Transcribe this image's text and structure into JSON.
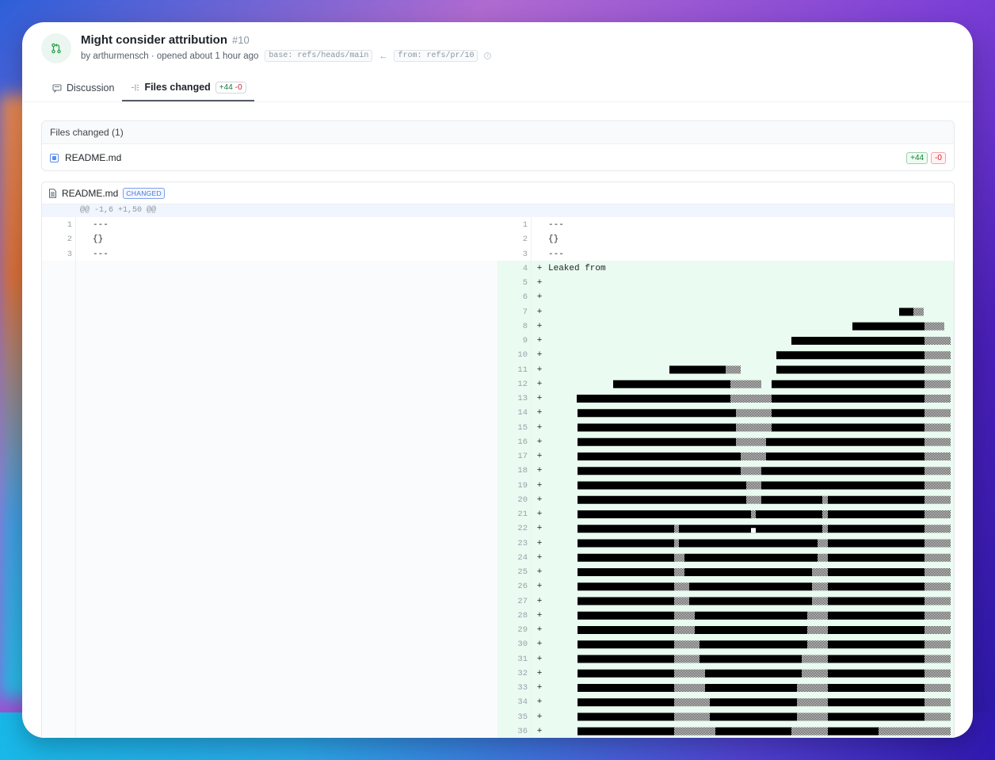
{
  "pr": {
    "title": "Might consider attribution",
    "number": "#10",
    "meta": "by arthurmensch · opened about 1 hour ago",
    "base_ref": "base: refs/heads/main",
    "arrow": "←",
    "from_ref": "from: refs/pr/10"
  },
  "tabs": [
    {
      "label": "Discussion"
    },
    {
      "label": "Files changed",
      "additions": "+44",
      "deletions": "-0"
    }
  ],
  "files_changed": {
    "heading": "Files changed (1)",
    "files": [
      {
        "name": "README.md",
        "additions": "+44",
        "deletions": "-0"
      }
    ]
  },
  "diff": {
    "file_name": "README.md",
    "status": "CHANGED",
    "hunk_header": "@@ -1,6 +1,50 @@",
    "left_lines": [
      {
        "num": "1",
        "text": "---"
      },
      {
        "num": "2",
        "text": "{}"
      },
      {
        "num": "3",
        "text": "---"
      }
    ],
    "right_lines": [
      {
        "num": "1",
        "marker": "",
        "text": "---"
      },
      {
        "num": "2",
        "marker": "",
        "text": "{}"
      },
      {
        "num": "3",
        "marker": "",
        "text": "---"
      },
      {
        "num": "4",
        "marker": "+",
        "text": "Leaked from"
      },
      {
        "num": "5",
        "marker": "+",
        "text": ""
      },
      {
        "num": "6",
        "marker": "+",
        "text": ""
      },
      {
        "num": "7",
        "marker": "+",
        "text": ""
      },
      {
        "num": "8",
        "marker": "+",
        "text": ""
      },
      {
        "num": "9",
        "marker": "+",
        "text": ""
      },
      {
        "num": "10",
        "marker": "+",
        "text": ""
      },
      {
        "num": "11",
        "marker": "+",
        "text": ""
      },
      {
        "num": "12",
        "marker": "+",
        "text": ""
      },
      {
        "num": "13",
        "marker": "+",
        "text": ""
      },
      {
        "num": "14",
        "marker": "+",
        "text": ""
      },
      {
        "num": "15",
        "marker": "+",
        "text": ""
      },
      {
        "num": "16",
        "marker": "+",
        "text": ""
      },
      {
        "num": "17",
        "marker": "+",
        "text": ""
      },
      {
        "num": "18",
        "marker": "+",
        "text": ""
      },
      {
        "num": "19",
        "marker": "+",
        "text": ""
      },
      {
        "num": "20",
        "marker": "+",
        "text": ""
      },
      {
        "num": "21",
        "marker": "+",
        "text": ""
      },
      {
        "num": "22",
        "marker": "+",
        "text": ""
      },
      {
        "num": "23",
        "marker": "+",
        "text": ""
      },
      {
        "num": "24",
        "marker": "+",
        "text": ""
      },
      {
        "num": "25",
        "marker": "+",
        "text": ""
      },
      {
        "num": "26",
        "marker": "+",
        "text": ""
      },
      {
        "num": "27",
        "marker": "+",
        "text": ""
      },
      {
        "num": "28",
        "marker": "+",
        "text": ""
      },
      {
        "num": "29",
        "marker": "+",
        "text": ""
      },
      {
        "num": "30",
        "marker": "+",
        "text": ""
      },
      {
        "num": "31",
        "marker": "+",
        "text": ""
      },
      {
        "num": "32",
        "marker": "+",
        "text": ""
      },
      {
        "num": "33",
        "marker": "+",
        "text": ""
      },
      {
        "num": "34",
        "marker": "+",
        "text": ""
      },
      {
        "num": "35",
        "marker": "+",
        "text": ""
      },
      {
        "num": "36",
        "marker": "+",
        "text": ""
      }
    ]
  },
  "icons": {
    "pr": "pull-request-icon",
    "discussion": "comment-icon",
    "files": "diff-icon",
    "file": "file-icon",
    "info": "info-icon"
  },
  "colors": {
    "addition_bg": "#eafbf1",
    "addition_text": "#1a7f37",
    "deletion_text": "#cf222e",
    "changed_badge": "#4a78d6"
  }
}
